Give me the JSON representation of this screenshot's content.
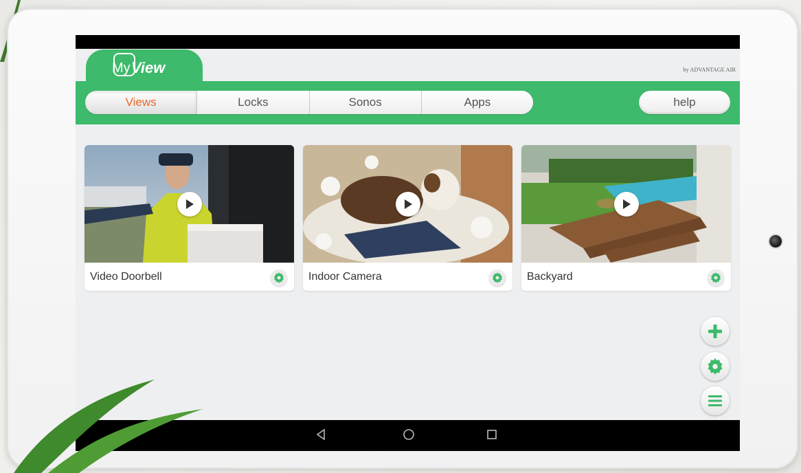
{
  "app": {
    "logo_my": "My",
    "logo_view": "View",
    "byline": "by ADVANTAGE AIR"
  },
  "nav": {
    "tabs": [
      {
        "label": "Views",
        "active": true
      },
      {
        "label": "Locks",
        "active": false
      },
      {
        "label": "Sonos",
        "active": false
      },
      {
        "label": "Apps",
        "active": false
      }
    ],
    "help_label": "help"
  },
  "cameras": [
    {
      "name": "Video Doorbell",
      "icon": "play-icon"
    },
    {
      "name": "Indoor Camera",
      "icon": "play-icon"
    },
    {
      "name": "Backyard",
      "icon": "play-icon"
    }
  ],
  "fabs": [
    {
      "icon": "plus-icon"
    },
    {
      "icon": "gear-icon"
    },
    {
      "icon": "menu-icon"
    }
  ],
  "android_nav": [
    "back-icon",
    "home-icon",
    "recents-icon"
  ],
  "colors": {
    "brand_green": "#3dba6b",
    "active_tab": "#e86a2a",
    "screen_bg": "#eeeff0"
  }
}
